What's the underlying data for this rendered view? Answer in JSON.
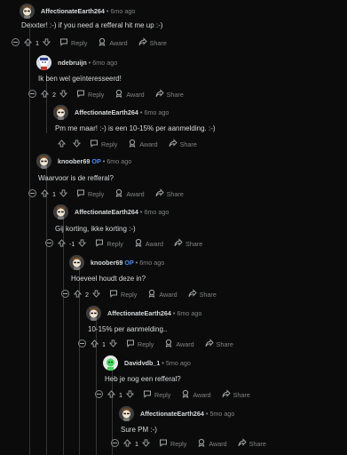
{
  "comments": [
    {
      "author": "AffectionateEarth264",
      "op": "",
      "time": "6mo ago",
      "text": "Dexxter! :-) if you need a refferal hit me up :-)",
      "votes": "1"
    },
    {
      "author": "ndebruijn",
      "op": "",
      "time": "6mo ago",
      "text": "Ik ben wel geïnteresseerd!",
      "votes": "2"
    },
    {
      "author": "AffectionateEarth264",
      "op": "",
      "time": "6mo ago",
      "text": "Pm me maar! :-) is een 10-15% per aanmelding. :-)",
      "votes": ""
    },
    {
      "author": "knoober69",
      "op": "OP",
      "time": "6mo ago",
      "text": "Waarvoor is de refferal?",
      "votes": "1"
    },
    {
      "author": "AffectionateEarth264",
      "op": "",
      "time": "6mo ago",
      "text": "Gij korting, ikke korting :-)",
      "votes": "-1"
    },
    {
      "author": "knoober69",
      "op": "OP",
      "time": "6mo ago",
      "text": "Hoeveel houdt deze in?",
      "votes": "2"
    },
    {
      "author": "AffectionateEarth264",
      "op": "",
      "time": "6mo ago",
      "text": "10-15% per aanmelding..",
      "votes": "1"
    },
    {
      "author": "Davidvdb_1",
      "op": "",
      "time": "5mo ago",
      "text": "Heb je nog een refferal?",
      "votes": "1"
    },
    {
      "author": "AffectionateEarth264",
      "op": "",
      "time": "5mo ago",
      "text": "Sure PM :-)",
      "votes": "1"
    }
  ],
  "labels": {
    "reply": "Reply",
    "award": "Award",
    "share": "Share",
    "more": "•••",
    "sep": "•"
  },
  "icons": {
    "upvote": "upvote-icon",
    "downvote": "downvote-icon",
    "reply": "reply-icon",
    "award": "award-icon",
    "share": "share-icon"
  },
  "colors": {
    "op": "#4a8cff",
    "background": "#0b0b0b",
    "muted": "#818384"
  }
}
